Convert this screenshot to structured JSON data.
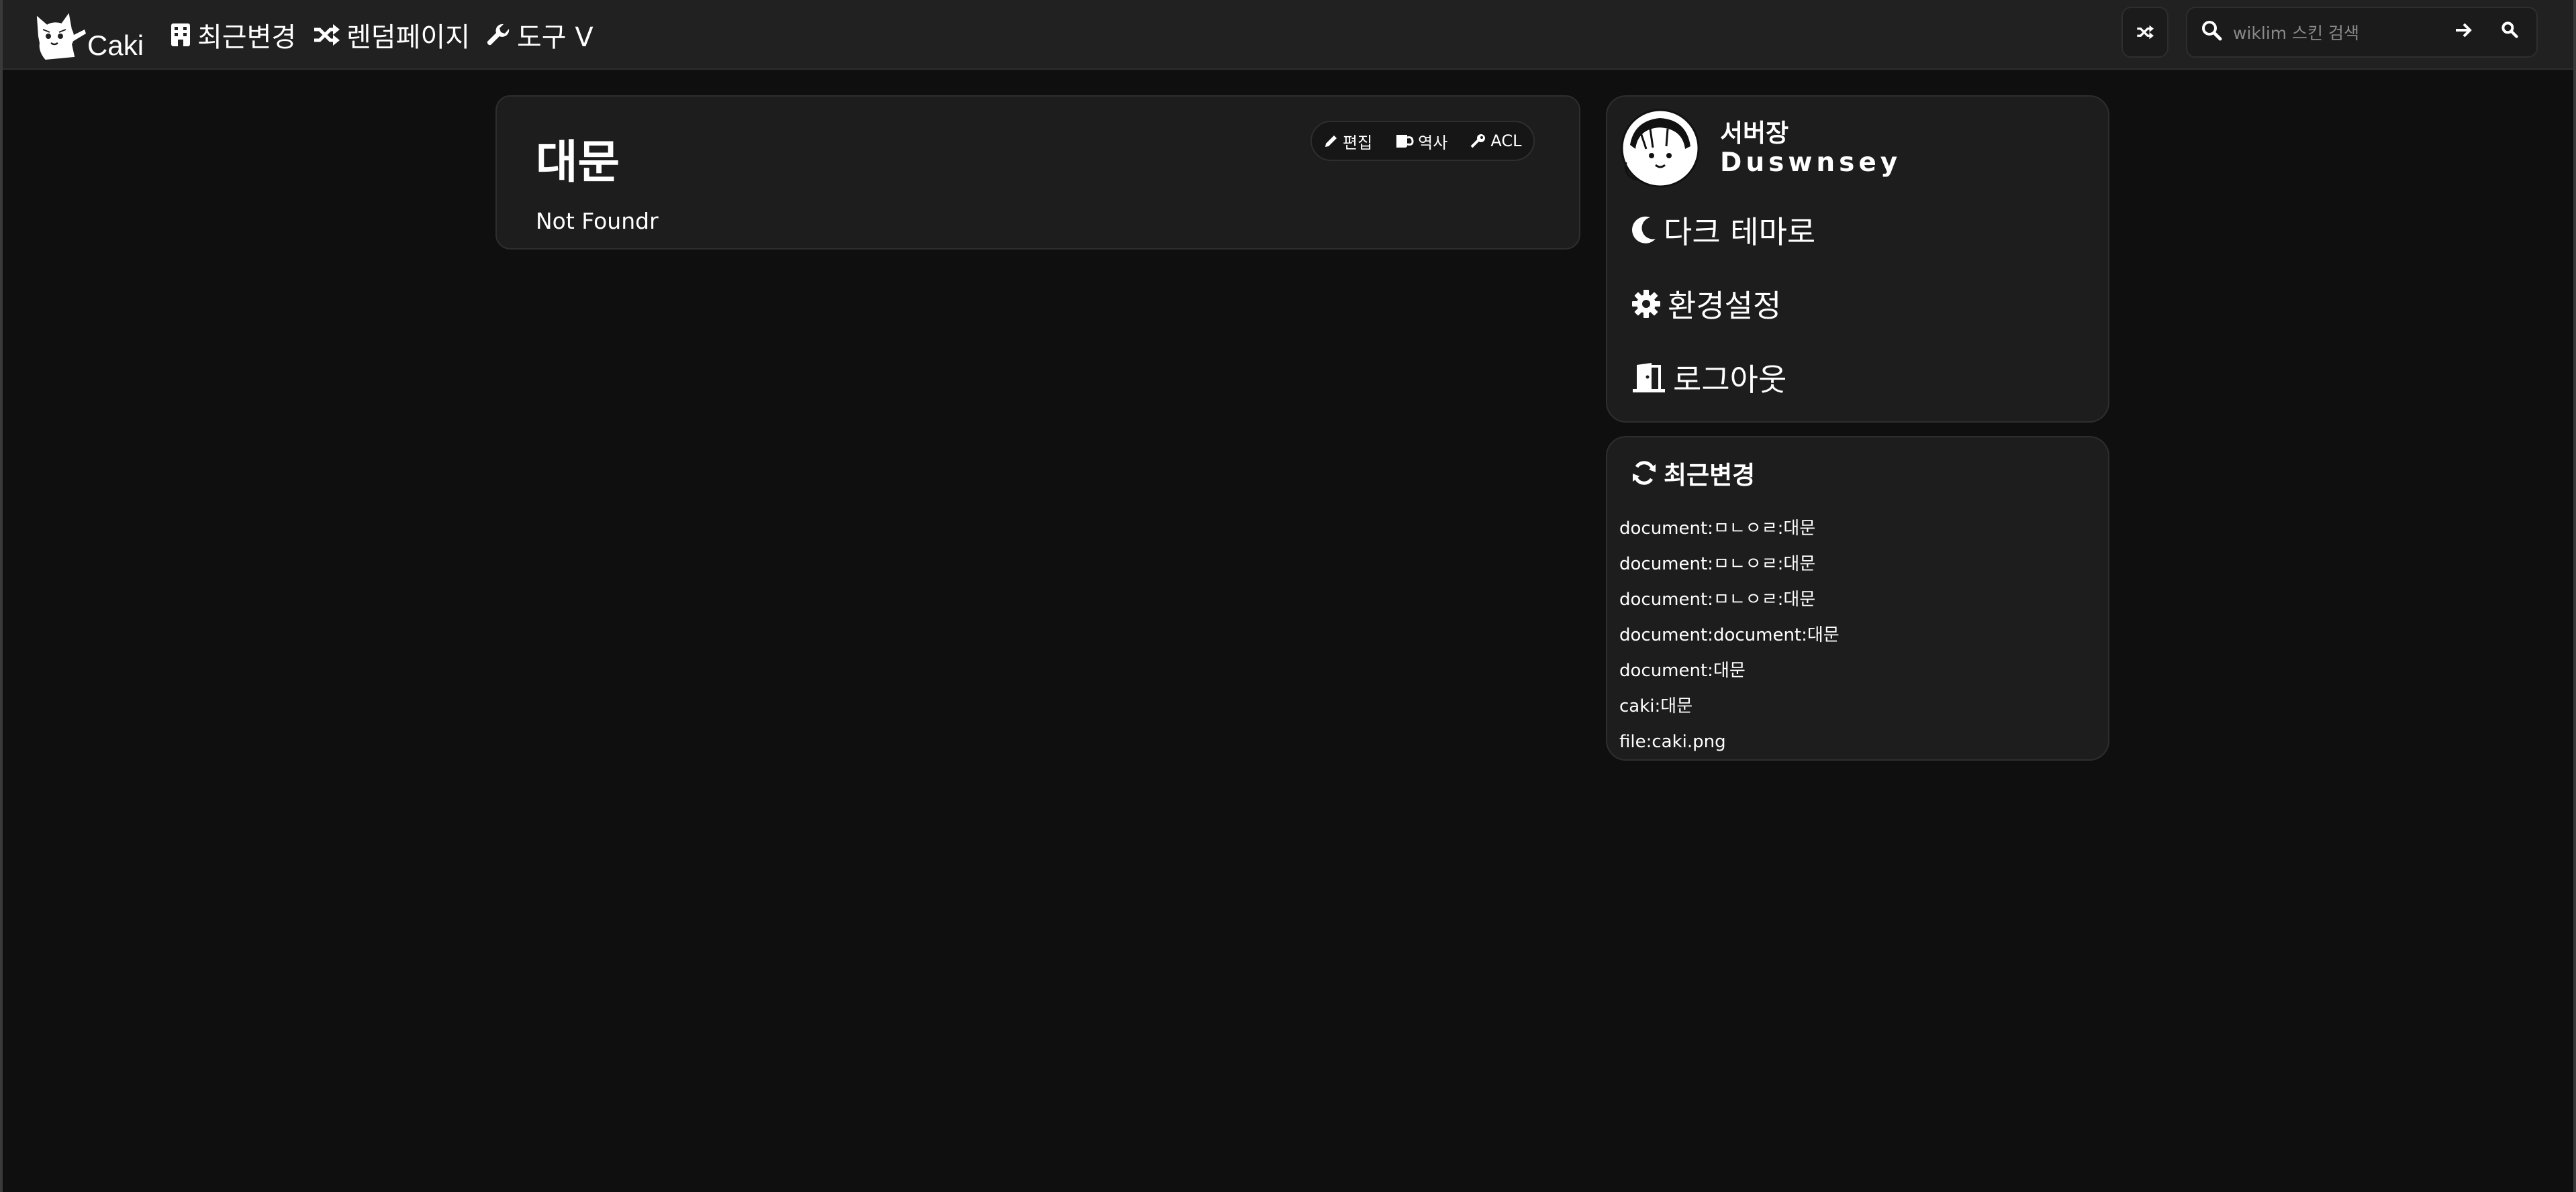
{
  "navbar": {
    "brand": "Caki",
    "items": [
      {
        "label": "최근변경",
        "icon": "building-icon"
      },
      {
        "label": "렌덤페이지",
        "icon": "shuffle-icon"
      },
      {
        "label": "도구 V",
        "icon": "wrench-icon"
      }
    ],
    "random_icon": "shuffle-icon",
    "search": {
      "placeholder": "wiklim 스킨 검색",
      "value": "",
      "go_icon": "arrow-right-icon",
      "search_icon": "search-icon"
    }
  },
  "article": {
    "title": "대문",
    "body": "Not Foundr",
    "tools": [
      {
        "label": "편집",
        "icon": "pencil-icon"
      },
      {
        "label": "역사",
        "icon": "history-icon"
      },
      {
        "label": "ACL",
        "icon": "key-icon"
      }
    ]
  },
  "user": {
    "role": "서버장",
    "name": "Duswnsey",
    "menu": [
      {
        "label": "다크 테마로",
        "icon": "moon-icon"
      },
      {
        "label": "환경설정",
        "icon": "gear-icon"
      },
      {
        "label": "로그아웃",
        "icon": "door-exit-icon"
      }
    ]
  },
  "recent": {
    "title": "최근변경",
    "icon": "refresh-icon",
    "items": [
      "document:ㅁㄴㅇㄹ:대문",
      "document:ㅁㄴㅇㄹ:대문",
      "document:ㅁㄴㅇㄹ:대문",
      "document:document:대문",
      "document:대문",
      "caki:대문",
      "file:caki.png"
    ]
  },
  "colors": {
    "page_bg": "#0f0f0f",
    "navbar_bg": "#212121",
    "card_bg": "#1d1d1d",
    "border": "#2e2e2e",
    "text": "#ffffff"
  }
}
